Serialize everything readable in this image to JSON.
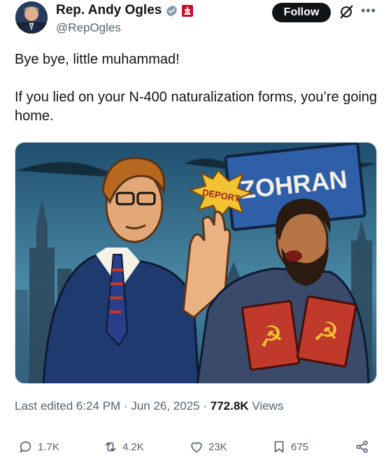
{
  "post": {
    "author_name": "Rep. Andy Ogles",
    "handle": "@RepOgles",
    "follow_label": "Follow",
    "text_line1": "Bye bye, little muhammad!",
    "text_line2": "If you lied on your N-400 naturalization forms, you’re going home.",
    "image_alt": "Comic-style illustration of a man in a suit holding up his hand toward an angry bearded man holding red books with hammer-and-sickle symbols"
  },
  "image_text": {
    "sign": "ZOHRAN",
    "burst": "DEPORT"
  },
  "meta": {
    "prefix": "Last edited 6:24 PM · Jun 26, 2025 · ",
    "views_count": "772.8K",
    "views_label": " Views"
  },
  "actions": {
    "replies": "1.7K",
    "reposts": "4.2K",
    "likes": "23K",
    "bookmarks": "675"
  },
  "colors": {
    "follow_bg": "#0f1419",
    "muted": "#536471",
    "verified": "#829aab"
  }
}
